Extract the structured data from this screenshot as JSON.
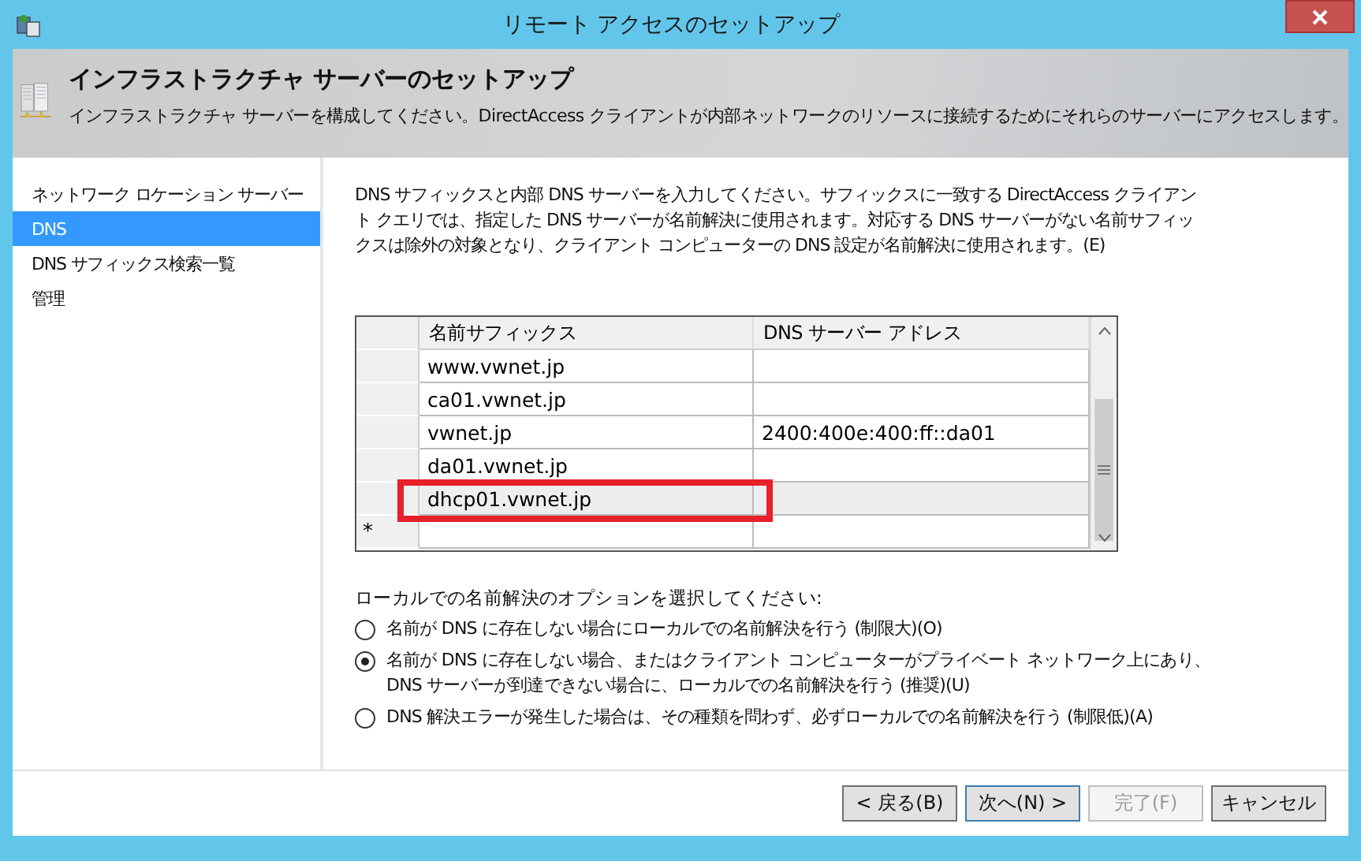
{
  "window": {
    "title": "リモート アクセスのセットアップ"
  },
  "header": {
    "title": "インフラストラクチャ サーバーのセットアップ",
    "subtitle": "インフラストラクチャ サーバーを構成してください。DirectAccess クライアントが内部ネットワークのリソースに接続するためにそれらのサーバーにアクセスします。"
  },
  "sidebar": {
    "items": [
      {
        "label": "ネットワーク ロケーション サーバー",
        "selected": false
      },
      {
        "label": "DNS",
        "selected": true
      },
      {
        "label": "DNS サフィックス検索一覧",
        "selected": false
      },
      {
        "label": "管理",
        "selected": false
      }
    ]
  },
  "description": "DNS サフィックスと内部 DNS サーバーを入力してください。サフィックスに一致する DirectAccess クライアント クエリでは、指定した DNS サーバーが名前解決に使用されます。対応する DNS サーバーがない名前サフィックスは除外の対象となり、クライアント コンピューターの DNS 設定が名前解決に使用されます。(E)",
  "table": {
    "columns": [
      "名前サフィックス",
      "DNS サーバー アドレス"
    ],
    "rows": [
      {
        "cells": [
          "www.vwnet.jp",
          ""
        ],
        "selected": false
      },
      {
        "cells": [
          "ca01.vwnet.jp",
          ""
        ],
        "selected": false
      },
      {
        "cells": [
          "vwnet.jp",
          "2400:400e:400:ff::da01"
        ],
        "selected": false
      },
      {
        "cells": [
          "da01.vwnet.jp",
          ""
        ],
        "selected": false
      },
      {
        "cells": [
          "dhcp01.vwnet.jp",
          ""
        ],
        "selected": true,
        "highlighted": true
      }
    ],
    "new_row_marker": "*"
  },
  "options": {
    "label": "ローカルでの名前解決のオプションを選択してください:",
    "items": [
      {
        "label": "名前が DNS に存在しない場合にローカルでの名前解決を行う (制限大)(O)",
        "selected": false
      },
      {
        "label": "名前が DNS に存在しない場合、またはクライアント コンピューターがプライベート ネットワーク上にあり、\nDNS サーバーが到達できない場合に、ローカルでの名前解決を行う (推奨)(U)",
        "selected": true
      },
      {
        "label": "DNS 解決エラーが発生した場合は、その種類を問わず、必ずローカルでの名前解決を行う (制限低)(A)",
        "selected": false
      }
    ]
  },
  "buttons": [
    {
      "label": "< 戻る(B)",
      "disabled": false,
      "default": false
    },
    {
      "label": "次へ(N) >",
      "disabled": false,
      "default": true
    },
    {
      "label": "完了(F)",
      "disabled": true,
      "default": false
    },
    {
      "label": "キャンセル",
      "disabled": false,
      "default": false
    }
  ]
}
